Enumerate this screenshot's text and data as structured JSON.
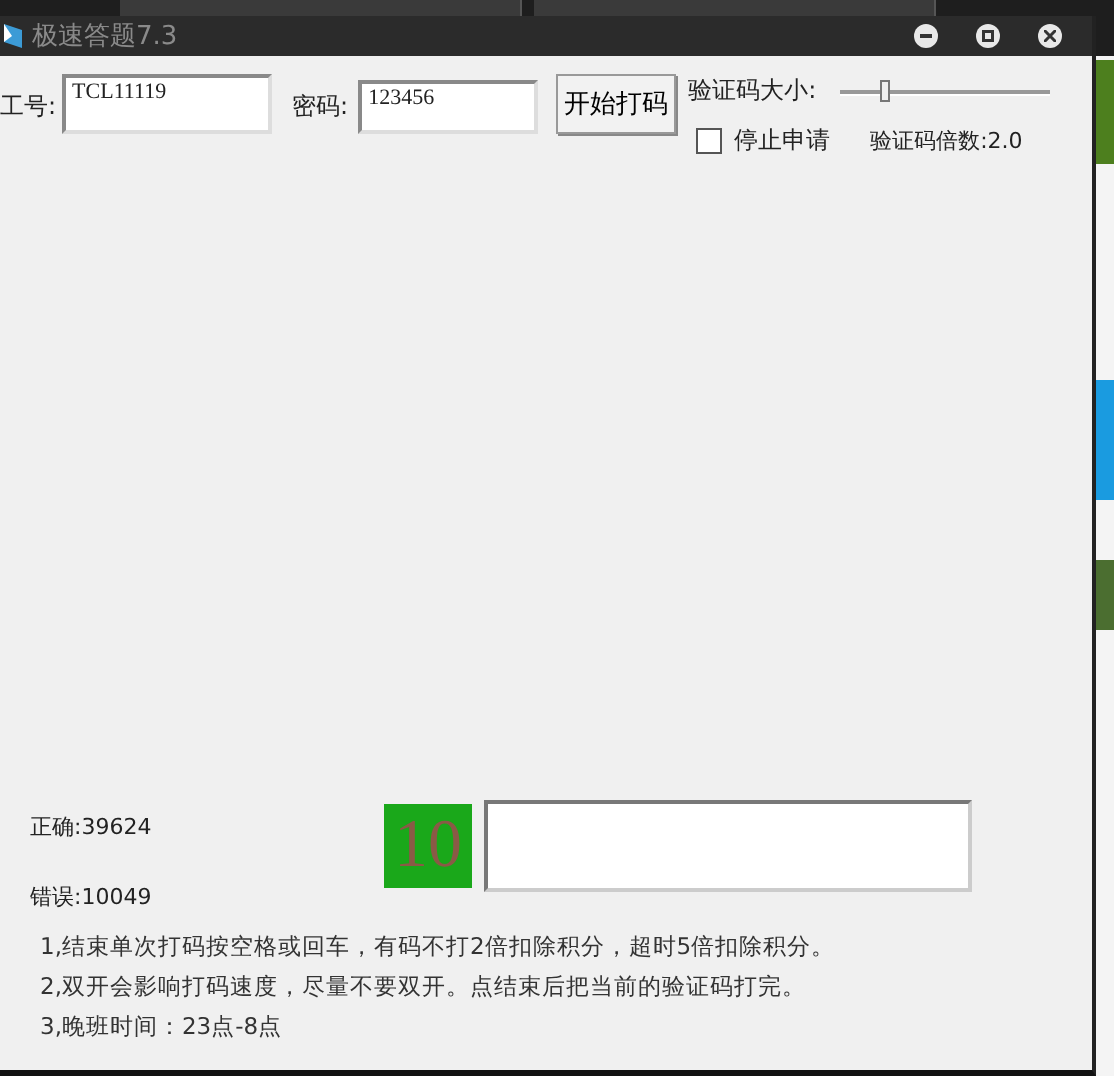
{
  "window": {
    "title": "极速答题7.3"
  },
  "login": {
    "user_label": "工号:",
    "user_value": "TCL11119",
    "password_label": "密码:",
    "password_value": "123456",
    "start_button": "开始打码"
  },
  "captcha_size": {
    "label": "验证码大小:",
    "level": 0.2
  },
  "stop_request": {
    "label": "停止申请",
    "checked": false
  },
  "multiplier": "验证码倍数:2.0",
  "stats": {
    "correct": "正确:39624",
    "wrong": "错误:10049"
  },
  "countdown": "10",
  "notes": [
    "1,结束单次打码按空格或回车，有码不打2倍扣除积分，超时5倍扣除积分。",
    "2,双开会影响打码速度，尽量不要双开。点结束后把当前的验证码打完。",
    "3,晚班时间：23点-8点"
  ]
}
